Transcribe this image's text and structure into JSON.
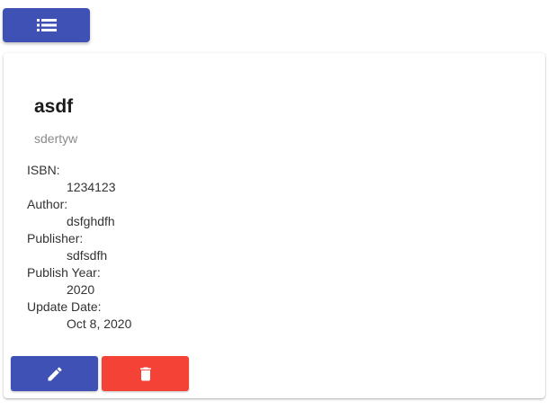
{
  "toolbar": {
    "list_icon": "list-icon",
    "list_button_color": "#3f51b5"
  },
  "book": {
    "title": "asdf",
    "subtitle": "sdertyw",
    "fields": [
      {
        "label": "ISBN:",
        "value": "1234123"
      },
      {
        "label": "Author:",
        "value": "dsfghdfh"
      },
      {
        "label": "Publisher:",
        "value": "sdfsdfh"
      },
      {
        "label": "Publish Year:",
        "value": "2020"
      },
      {
        "label": "Update Date:",
        "value": "Oct 8, 2020"
      }
    ]
  },
  "actions": {
    "edit_icon": "pencil-icon",
    "edit_color": "#3f51b5",
    "delete_icon": "trash-icon",
    "delete_color": "#f44336"
  }
}
